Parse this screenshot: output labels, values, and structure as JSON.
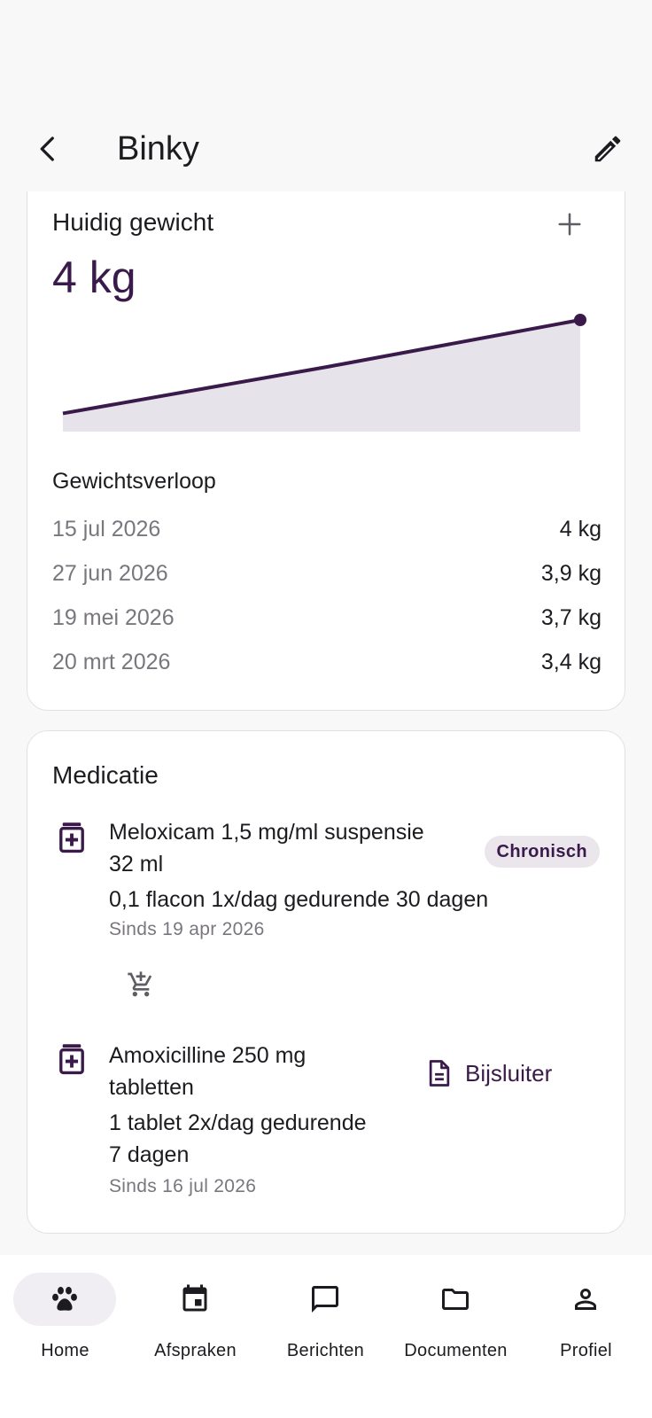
{
  "app_bar": {
    "title": "Binky",
    "back_icon": "chevron-left-icon",
    "edit_icon": "pencil-icon"
  },
  "weight": {
    "heading": "Huidig gewicht",
    "current": "4 kg",
    "history_heading": "Gewichtsverloop",
    "history": [
      {
        "date": "15 jul 2026",
        "value": "4 kg"
      },
      {
        "date": "27 jun 2026",
        "value": "3,9 kg"
      },
      {
        "date": "19 mei 2026",
        "value": "3,7 kg"
      },
      {
        "date": "20 mrt 2026",
        "value": "3,4 kg"
      }
    ]
  },
  "chart_data": {
    "type": "area",
    "x": [
      "20 mrt 2026",
      "19 mei 2026",
      "15 jul 2026"
    ],
    "values": [
      3.4,
      3.7,
      4.0
    ],
    "ylim": [
      3.34,
      4.0
    ],
    "grid": false,
    "colors": {
      "line": "#3a1a4a",
      "fill": "#e7e3ea"
    }
  },
  "medication": {
    "heading": "Medicatie",
    "items": [
      {
        "name_line1": "Meloxicam 1,5 mg/ml suspensie",
        "name_line2": "32 ml",
        "dose_line1": "0,1 flacon 1x/dag gedurende 30 dagen",
        "dose_line2": "",
        "since": "Sinds 19 apr 2026",
        "badge": "Chronisch",
        "action_icon": "add-shopping-cart-icon"
      },
      {
        "name_line1": "Amoxicilline 250 mg",
        "name_line2": "tabletten",
        "dose_line1": "1 tablet 2x/dag gedurende",
        "dose_line2": "7 dagen",
        "since": "Sinds 16 jul 2026",
        "action_label": "Bijsluiter",
        "action_icon": "document-icon"
      }
    ]
  },
  "bottom_nav": {
    "active": "Home",
    "items": [
      {
        "label": "Home",
        "icon": "paw-icon"
      },
      {
        "label": "Afspraken",
        "icon": "calendar-icon"
      },
      {
        "label": "Berichten",
        "icon": "message-icon"
      },
      {
        "label": "Documenten",
        "icon": "folder-icon"
      },
      {
        "label": "Profiel",
        "icon": "person-icon"
      }
    ]
  },
  "colors": {
    "accent": "#3a1a4a",
    "chip_bg": "#eae6ec",
    "muted_text": "#79767d"
  }
}
